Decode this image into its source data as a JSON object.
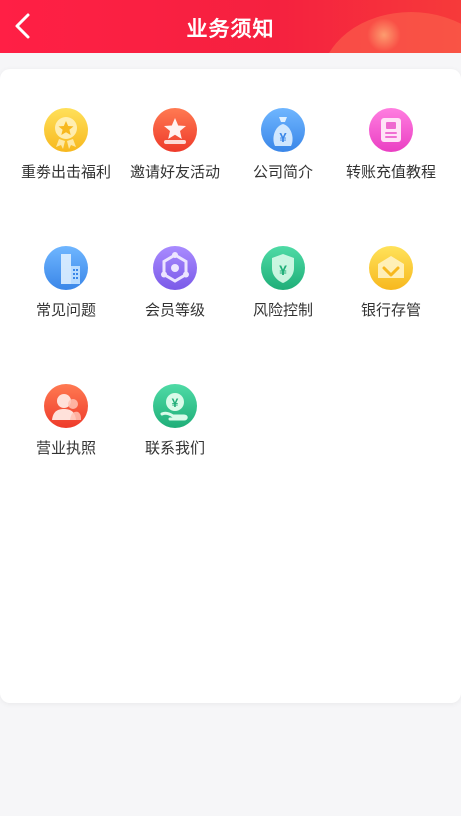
{
  "header": {
    "title": "业务须知",
    "back_icon": "chevron-left-icon",
    "background_color": "#ff1f45"
  },
  "items": [
    {
      "label": "重劵出击福利",
      "icon": "medal-icon",
      "color": "#fcc72c"
    },
    {
      "label": "邀请好友活动",
      "icon": "star-icon",
      "color": "#f55032"
    },
    {
      "label": "公司简介",
      "icon": "money-bag-icon",
      "color": "#4d9cf0"
    },
    {
      "label": "转账充值教程",
      "icon": "document-icon",
      "color": "#f54fcf"
    },
    {
      "label": "常见问题",
      "icon": "building-icon",
      "color": "#4d9cf0"
    },
    {
      "label": "会员等级",
      "icon": "hexagon-icon",
      "color": "#8c6ef0"
    },
    {
      "label": "风险控制",
      "icon": "shield-yen-icon",
      "color": "#2cc28a"
    },
    {
      "label": "银行存管",
      "icon": "wallet-icon",
      "color": "#fcc72c"
    },
    {
      "label": "营业执照",
      "icon": "people-icon",
      "color": "#f55032"
    },
    {
      "label": "联系我们",
      "icon": "hand-coin-icon",
      "color": "#2cc28a"
    }
  ]
}
